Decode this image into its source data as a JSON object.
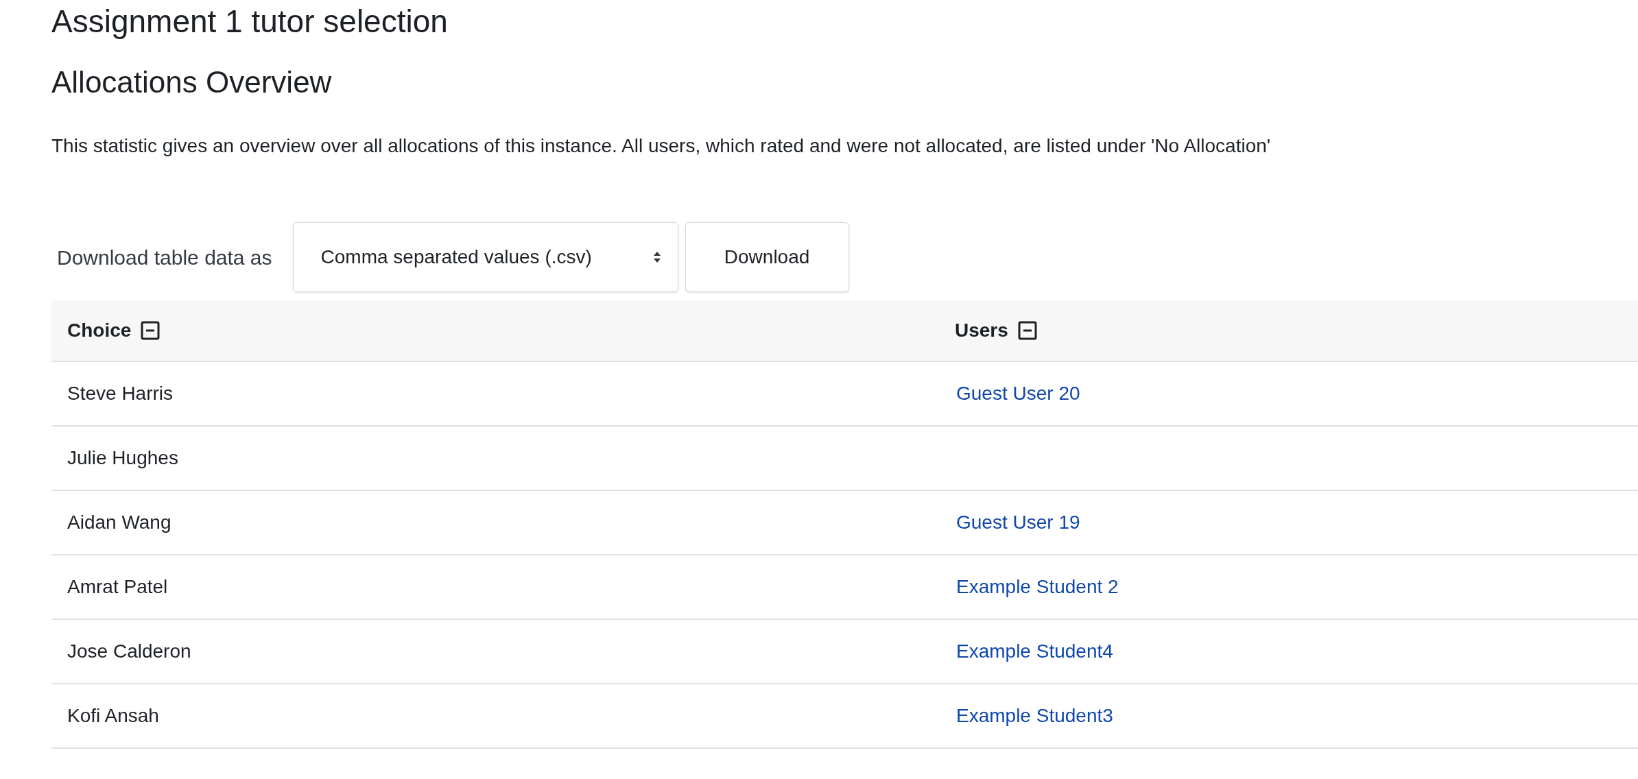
{
  "title": "Assignment 1 tutor selection",
  "section_title": "Allocations Overview",
  "description": "This statistic gives an overview over all allocations of this instance. All users, which rated and were not allocated, are listed under 'No Allocation'",
  "download": {
    "label": "Download table data as",
    "format": "Comma separated values (.csv)",
    "button": "Download"
  },
  "table": {
    "columns": [
      {
        "label": "Choice"
      },
      {
        "label": "Users"
      }
    ],
    "rows": [
      {
        "choice": "Steve Harris",
        "users": [
          "Guest User 20"
        ]
      },
      {
        "choice": "Julie Hughes",
        "users": []
      },
      {
        "choice": "Aidan Wang",
        "users": [
          "Guest User 19"
        ]
      },
      {
        "choice": "Amrat Patel",
        "users": [
          "Example Student 2"
        ]
      },
      {
        "choice": "Jose Calderon",
        "users": [
          "Example Student4"
        ]
      },
      {
        "choice": "Kofi Ansah",
        "users": [
          "Example Student3"
        ]
      }
    ]
  }
}
